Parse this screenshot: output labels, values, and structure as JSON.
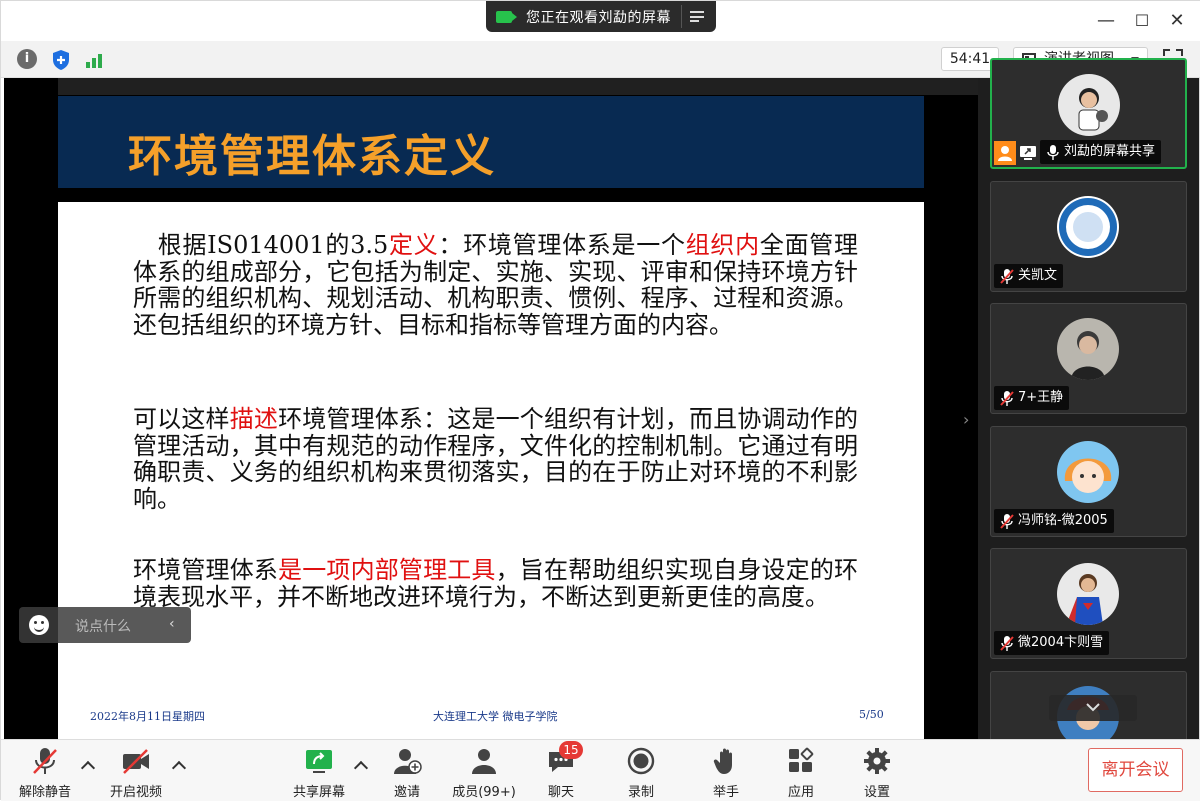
{
  "window": {
    "share_banner": "您正在观看刘勐的屏幕",
    "controls": {
      "minimize": "—",
      "maximize": "☐",
      "close": "✕"
    }
  },
  "topbar": {
    "timer": "54:41",
    "view_mode": "演讲者视图"
  },
  "slide": {
    "title": "环境管理体系定义",
    "para1_a": "　根据IS014001的3.5",
    "para1_red1": "定义",
    "para1_b": "：环境管理体系是一个",
    "para1_red2": "组织内",
    "para1_c": "全面管理体系的组成部分，它包括为制定、实施、实现、评审和保持环境方针所需的组织机构、规划活动、机构职责、惯例、程序、过程和资源。还包括组织的环境方针、目标和指标等管理方面的内容。",
    "para2_a": "可以这样",
    "para2_red": "描述",
    "para2_b": "环境管理体系：这是一个组织有计划，而且协调动作的管理活动，其中有规范的动作程序，文件化的控制机制。它通过有明确职责、义务的组织机构来贯彻落实，目的在于防止对环境的不利影响。",
    "para3_a": "环境管理体系",
    "para3_red": "是一项内部管理工具",
    "para3_b": "，旨在帮助组织实现自身设定的环境表现水平，并不断地改进环境行为，不断达到更新更佳的高度。",
    "footer_date": "2022年8月11日星期四",
    "footer_org": "大连理工大学 微电子学院",
    "footer_page": "5/50"
  },
  "chat_input": {
    "placeholder": "说点什么"
  },
  "participants": [
    {
      "name": "刘勐的屏幕共享",
      "active": true
    },
    {
      "name": "关凯文"
    },
    {
      "name": "7+王静"
    },
    {
      "name": "冯师铭-微2005"
    },
    {
      "name": "微2004卞则雪"
    }
  ],
  "toolbar": {
    "mute": "解除静音",
    "video": "开启视频",
    "share": "共享屏幕",
    "invite": "邀请",
    "members": "成员(99+)",
    "chat": "聊天",
    "chat_badge": "15",
    "record": "录制",
    "raise_hand": "举手",
    "apps": "应用",
    "settings": "设置",
    "leave": "离开会议"
  },
  "colors": {
    "accent_green": "#22b14c",
    "leave_red": "#e0483e",
    "slide_title": "#f5a02a",
    "slide_band": "#082a52"
  }
}
